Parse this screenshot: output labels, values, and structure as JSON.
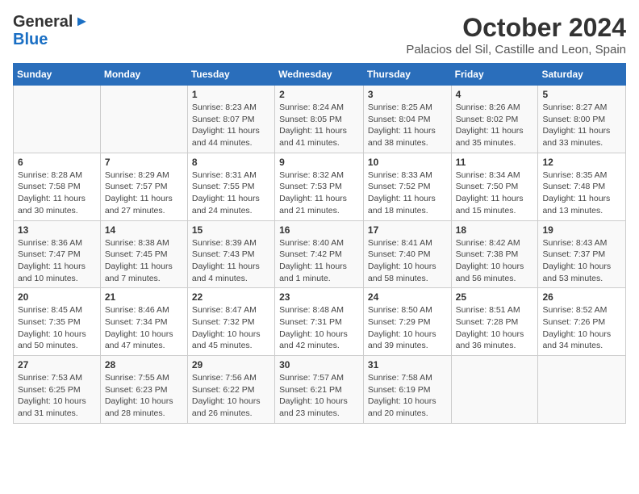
{
  "logo": {
    "general": "General",
    "blue": "Blue"
  },
  "title": {
    "month": "October 2024",
    "location": "Palacios del Sil, Castille and Leon, Spain"
  },
  "headers": [
    "Sunday",
    "Monday",
    "Tuesday",
    "Wednesday",
    "Thursday",
    "Friday",
    "Saturday"
  ],
  "weeks": [
    [
      {
        "day": "",
        "info": ""
      },
      {
        "day": "",
        "info": ""
      },
      {
        "day": "1",
        "info": "Sunrise: 8:23 AM\nSunset: 8:07 PM\nDaylight: 11 hours and 44 minutes."
      },
      {
        "day": "2",
        "info": "Sunrise: 8:24 AM\nSunset: 8:05 PM\nDaylight: 11 hours and 41 minutes."
      },
      {
        "day": "3",
        "info": "Sunrise: 8:25 AM\nSunset: 8:04 PM\nDaylight: 11 hours and 38 minutes."
      },
      {
        "day": "4",
        "info": "Sunrise: 8:26 AM\nSunset: 8:02 PM\nDaylight: 11 hours and 35 minutes."
      },
      {
        "day": "5",
        "info": "Sunrise: 8:27 AM\nSunset: 8:00 PM\nDaylight: 11 hours and 33 minutes."
      }
    ],
    [
      {
        "day": "6",
        "info": "Sunrise: 8:28 AM\nSunset: 7:58 PM\nDaylight: 11 hours and 30 minutes."
      },
      {
        "day": "7",
        "info": "Sunrise: 8:29 AM\nSunset: 7:57 PM\nDaylight: 11 hours and 27 minutes."
      },
      {
        "day": "8",
        "info": "Sunrise: 8:31 AM\nSunset: 7:55 PM\nDaylight: 11 hours and 24 minutes."
      },
      {
        "day": "9",
        "info": "Sunrise: 8:32 AM\nSunset: 7:53 PM\nDaylight: 11 hours and 21 minutes."
      },
      {
        "day": "10",
        "info": "Sunrise: 8:33 AM\nSunset: 7:52 PM\nDaylight: 11 hours and 18 minutes."
      },
      {
        "day": "11",
        "info": "Sunrise: 8:34 AM\nSunset: 7:50 PM\nDaylight: 11 hours and 15 minutes."
      },
      {
        "day": "12",
        "info": "Sunrise: 8:35 AM\nSunset: 7:48 PM\nDaylight: 11 hours and 13 minutes."
      }
    ],
    [
      {
        "day": "13",
        "info": "Sunrise: 8:36 AM\nSunset: 7:47 PM\nDaylight: 11 hours and 10 minutes."
      },
      {
        "day": "14",
        "info": "Sunrise: 8:38 AM\nSunset: 7:45 PM\nDaylight: 11 hours and 7 minutes."
      },
      {
        "day": "15",
        "info": "Sunrise: 8:39 AM\nSunset: 7:43 PM\nDaylight: 11 hours and 4 minutes."
      },
      {
        "day": "16",
        "info": "Sunrise: 8:40 AM\nSunset: 7:42 PM\nDaylight: 11 hours and 1 minute."
      },
      {
        "day": "17",
        "info": "Sunrise: 8:41 AM\nSunset: 7:40 PM\nDaylight: 10 hours and 58 minutes."
      },
      {
        "day": "18",
        "info": "Sunrise: 8:42 AM\nSunset: 7:38 PM\nDaylight: 10 hours and 56 minutes."
      },
      {
        "day": "19",
        "info": "Sunrise: 8:43 AM\nSunset: 7:37 PM\nDaylight: 10 hours and 53 minutes."
      }
    ],
    [
      {
        "day": "20",
        "info": "Sunrise: 8:45 AM\nSunset: 7:35 PM\nDaylight: 10 hours and 50 minutes."
      },
      {
        "day": "21",
        "info": "Sunrise: 8:46 AM\nSunset: 7:34 PM\nDaylight: 10 hours and 47 minutes."
      },
      {
        "day": "22",
        "info": "Sunrise: 8:47 AM\nSunset: 7:32 PM\nDaylight: 10 hours and 45 minutes."
      },
      {
        "day": "23",
        "info": "Sunrise: 8:48 AM\nSunset: 7:31 PM\nDaylight: 10 hours and 42 minutes."
      },
      {
        "day": "24",
        "info": "Sunrise: 8:50 AM\nSunset: 7:29 PM\nDaylight: 10 hours and 39 minutes."
      },
      {
        "day": "25",
        "info": "Sunrise: 8:51 AM\nSunset: 7:28 PM\nDaylight: 10 hours and 36 minutes."
      },
      {
        "day": "26",
        "info": "Sunrise: 8:52 AM\nSunset: 7:26 PM\nDaylight: 10 hours and 34 minutes."
      }
    ],
    [
      {
        "day": "27",
        "info": "Sunrise: 7:53 AM\nSunset: 6:25 PM\nDaylight: 10 hours and 31 minutes."
      },
      {
        "day": "28",
        "info": "Sunrise: 7:55 AM\nSunset: 6:23 PM\nDaylight: 10 hours and 28 minutes."
      },
      {
        "day": "29",
        "info": "Sunrise: 7:56 AM\nSunset: 6:22 PM\nDaylight: 10 hours and 26 minutes."
      },
      {
        "day": "30",
        "info": "Sunrise: 7:57 AM\nSunset: 6:21 PM\nDaylight: 10 hours and 23 minutes."
      },
      {
        "day": "31",
        "info": "Sunrise: 7:58 AM\nSunset: 6:19 PM\nDaylight: 10 hours and 20 minutes."
      },
      {
        "day": "",
        "info": ""
      },
      {
        "day": "",
        "info": ""
      }
    ]
  ]
}
